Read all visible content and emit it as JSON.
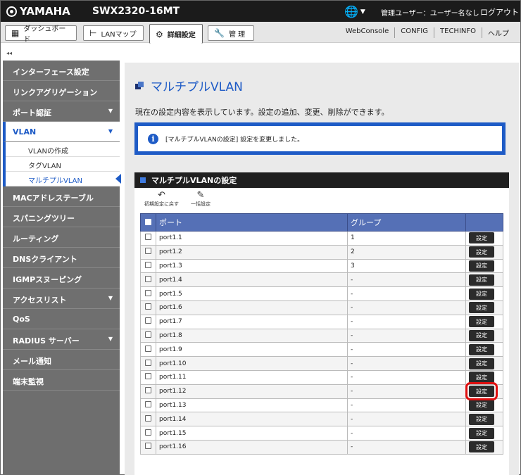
{
  "header": {
    "brand": "YAMAHA",
    "model": "SWX2320-16MT",
    "user_text": "管理ユーザー：ユーザー名なし",
    "logout": "ログアウト"
  },
  "nav": {
    "dashboard": "ダッシュボード",
    "lanmap": "LANマップ",
    "advanced": "詳細設定",
    "manage": "管 理",
    "links": [
      "WebConsole",
      "CONFIG",
      "TECHINFO",
      "ヘルプ"
    ]
  },
  "collapse": "◂◂",
  "sidebar": {
    "items": [
      {
        "label": "インターフェース設定",
        "arrow": ""
      },
      {
        "label": "リンクアグリゲーション",
        "arrow": ""
      },
      {
        "label": "ポート認証",
        "arrow": "▼"
      },
      {
        "label": "VLAN",
        "arrow": "▼"
      },
      {
        "label": "MACアドレステーブル",
        "arrow": ""
      },
      {
        "label": "スパニングツリー",
        "arrow": ""
      },
      {
        "label": "ルーティング",
        "arrow": ""
      },
      {
        "label": "DNSクライアント",
        "arrow": ""
      },
      {
        "label": "IGMPスヌーピング",
        "arrow": ""
      },
      {
        "label": "アクセスリスト",
        "arrow": "▼"
      },
      {
        "label": "QoS",
        "arrow": ""
      },
      {
        "label": "RADIUS サーバー",
        "arrow": "▼"
      },
      {
        "label": "メール通知",
        "arrow": ""
      },
      {
        "label": "端末監視",
        "arrow": ""
      }
    ],
    "vlan_sub": [
      "VLANの作成",
      "タグVLAN",
      "マルチプルVLAN"
    ]
  },
  "main": {
    "title": "マルチプルVLAN",
    "description": "現在の設定内容を表示しています。設定の追加、変更、削除ができます。",
    "notice": "[マルチプルVLANの設定] 設定を変更しました。",
    "panel_title": "マルチプルVLANの設定",
    "tool_reset": "初期設定に戻す",
    "tool_bulk": "一括設定",
    "col_port": "ポート",
    "col_group": "グループ",
    "set_label": "設定",
    "rows": [
      {
        "port": "port1.1",
        "group": "1"
      },
      {
        "port": "port1.2",
        "group": "2"
      },
      {
        "port": "port1.3",
        "group": "3"
      },
      {
        "port": "port1.4",
        "group": "-"
      },
      {
        "port": "port1.5",
        "group": "-"
      },
      {
        "port": "port1.6",
        "group": "-"
      },
      {
        "port": "port1.7",
        "group": "-"
      },
      {
        "port": "port1.8",
        "group": "-"
      },
      {
        "port": "port1.9",
        "group": "-"
      },
      {
        "port": "port1.10",
        "group": "-"
      },
      {
        "port": "port1.11",
        "group": "-"
      },
      {
        "port": "port1.12",
        "group": "-"
      },
      {
        "port": "port1.13",
        "group": "-"
      },
      {
        "port": "port1.14",
        "group": "-"
      },
      {
        "port": "port1.15",
        "group": "-"
      },
      {
        "port": "port1.16",
        "group": "-"
      }
    ],
    "highlighted_row": 11
  }
}
